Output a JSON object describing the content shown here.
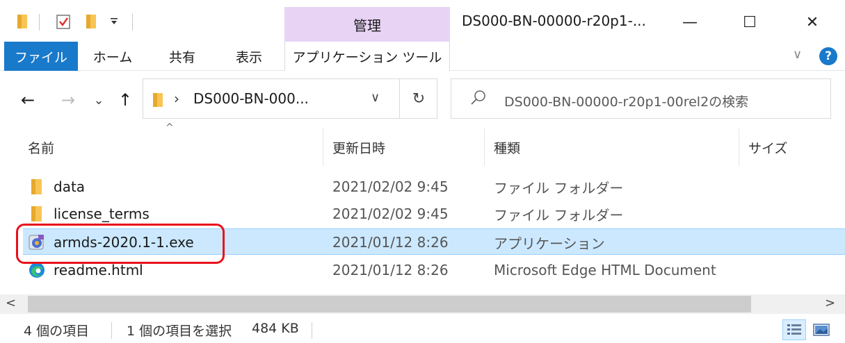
{
  "titlebar": {
    "manage_tab": "管理",
    "window_title": "DS000-BN-00000-r20p1-...",
    "minimize_glyph": "—",
    "maximize_glyph": "☐",
    "close_glyph": "✕"
  },
  "ribbon": {
    "tabs": [
      "ファイル",
      "ホーム",
      "共有",
      "表示",
      "アプリケーション ツール"
    ],
    "help_glyph": "?",
    "collapse_glyph": "∨"
  },
  "address": {
    "path": "DS000-BN-000...",
    "breadcrumb_sep": "›",
    "dropdown_glyph": "∨",
    "refresh_glyph": "↻"
  },
  "nav": {
    "back_glyph": "←",
    "forward_glyph": "→",
    "recent_glyph": "⌄",
    "up_glyph": "↑"
  },
  "search": {
    "placeholder": "DS000-BN-00000-r20p1-00rel2の検索"
  },
  "columns": {
    "name": "名前",
    "modified": "更新日時",
    "type": "種類",
    "size": "サイズ",
    "sort_glyph": "^"
  },
  "files": [
    {
      "name": "data",
      "modified": "2021/02/02 9:45",
      "type": "ファイル フォルダー",
      "icon": "folder-icon",
      "selected": false
    },
    {
      "name": "license_terms",
      "modified": "2021/02/02 9:45",
      "type": "ファイル フォルダー",
      "icon": "folder-icon",
      "selected": false
    },
    {
      "name": "armds-2020.1-1.exe",
      "modified": "2021/01/12 8:26",
      "type": "アプリケーション",
      "icon": "installer-icon",
      "selected": true
    },
    {
      "name": "readme.html",
      "modified": "2021/01/12 8:26",
      "type": "Microsoft Edge HTML Document",
      "icon": "edge-icon",
      "selected": false
    }
  ],
  "scrollbar": {
    "left_glyph": "<",
    "right_glyph": ">"
  },
  "status": {
    "item_count": "4 個の項目",
    "selection": "1 個の項目を選択",
    "size": "484 KB"
  },
  "colors": {
    "accent": "#1979ca",
    "manage_tab": "#e8d3f5",
    "selection": "#cce8ff",
    "highlight": "#e8101a",
    "folder": "#f8c555"
  }
}
